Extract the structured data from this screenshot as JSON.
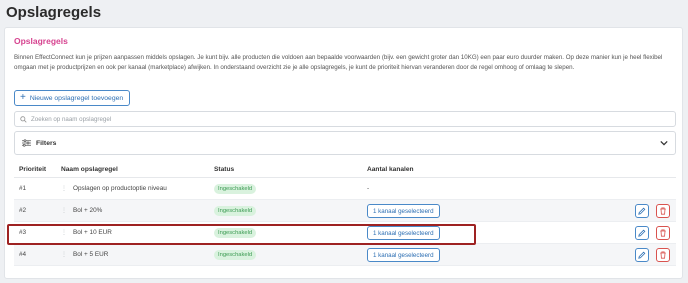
{
  "page": {
    "title": "Opslagregels"
  },
  "section": {
    "title": "Opslagregels",
    "description": "Binnen EffectConnect kun je prijzen aanpassen middels opslagen. Je kunt bijv. alle producten die voldoen aan bepaalde voorwaarden (bijv. een gewicht groter dan 10KG) een paar euro duurder maken. Op deze manier kun je heel flexibel omgaan met je productprijzen en ook per kanaal (marketplace) afwijken. In onderstaand overzicht zie je alle opslagregels, je kunt de prioriteit hiervan veranderen door de regel omhoog of omlaag te slepen."
  },
  "toolbar": {
    "add_label": "Nieuwe opslagregel toevoegen"
  },
  "search": {
    "placeholder": "Zoeken op naam opslagregel"
  },
  "filters": {
    "label": "Filters"
  },
  "table": {
    "headers": {
      "priority": "Prioriteit",
      "name": "Naam opslagregel",
      "status": "Status",
      "channels": "Aantal kanalen"
    },
    "rows": [
      {
        "priority": "#1",
        "name": "Opslagen op productoptie niveau",
        "status": "Ingeschakeld",
        "channels": "-"
      },
      {
        "priority": "#2",
        "name": "Bol + 20%",
        "status": "Ingeschakeld",
        "channels": "1 kanaal geselecteerd"
      },
      {
        "priority": "#3",
        "name": "Bol + 10 EUR",
        "status": "Ingeschakeld",
        "channels": "1 kanaal geselecteerd"
      },
      {
        "priority": "#4",
        "name": "Bol + 5 EUR",
        "status": "Ingeschakeld",
        "channels": "1 kanaal geselecteerd"
      }
    ]
  },
  "colors": {
    "accent": "#d6428f",
    "primary": "#2d6fb3",
    "danger": "#d9534f",
    "success_bg": "#d9f2de",
    "success_text": "#3b9a52",
    "highlight": "#9e2222"
  },
  "icons": {
    "add": "plus-icon",
    "search": "search-icon",
    "filters": "sliders-icon",
    "chevron": "chevron-down-icon",
    "drag": "drag-handle-icon",
    "edit": "pencil-icon",
    "delete": "trash-icon"
  }
}
